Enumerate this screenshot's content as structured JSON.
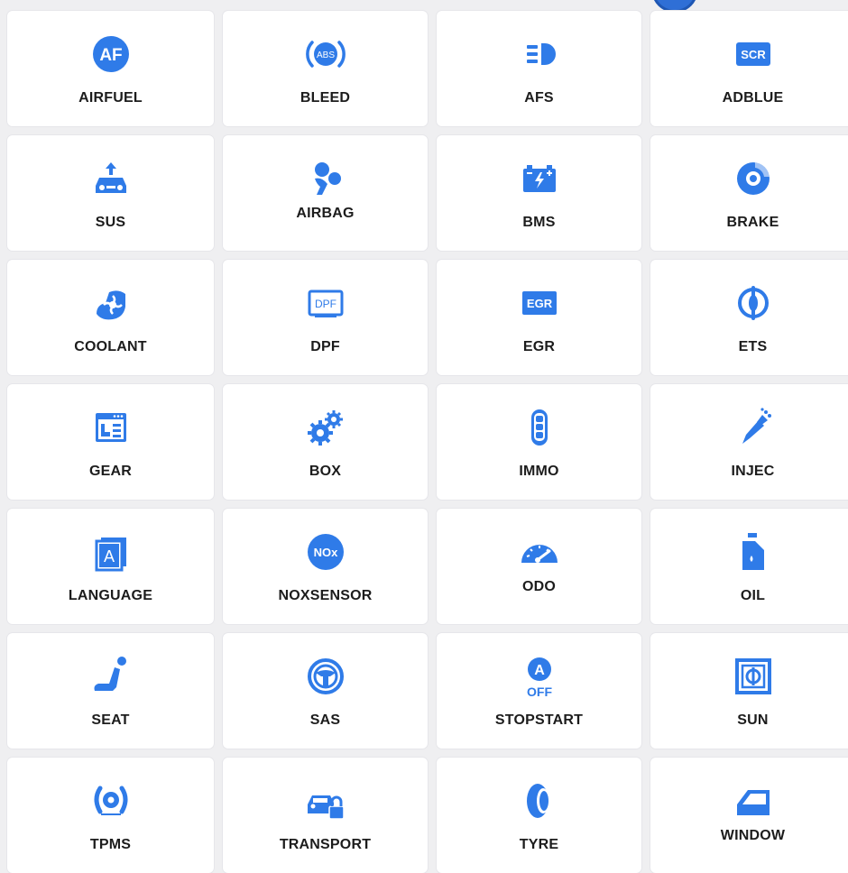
{
  "accent_color": "#2f7be8",
  "tiles": [
    {
      "label": "AIRFUEL",
      "icon": "airfuel-icon",
      "badge": "AF"
    },
    {
      "label": "BLEED",
      "icon": "abs-icon",
      "badge": "ABS"
    },
    {
      "label": "AFS",
      "icon": "headlight-icon"
    },
    {
      "label": "ADBLUE",
      "icon": "scr-icon",
      "badge": "SCR"
    },
    {
      "label": "SUS",
      "icon": "suspension-icon"
    },
    {
      "label": "AIRBAG",
      "icon": "airbag-icon"
    },
    {
      "label": "BMS",
      "icon": "battery-icon"
    },
    {
      "label": "BRAKE",
      "icon": "brake-disc-icon"
    },
    {
      "label": "COOLANT",
      "icon": "coolant-fan-icon"
    },
    {
      "label": "DPF",
      "icon": "dpf-icon",
      "badge": "DPF"
    },
    {
      "label": "EGR",
      "icon": "egr-icon",
      "badge": "EGR"
    },
    {
      "label": "ETS",
      "icon": "throttle-icon"
    },
    {
      "label": "GEAR",
      "icon": "gearbox-window-icon"
    },
    {
      "label": "BOX",
      "icon": "gears-icon"
    },
    {
      "label": "IMMO",
      "icon": "key-fob-icon"
    },
    {
      "label": "INJEC",
      "icon": "injector-icon"
    },
    {
      "label": "LANGUAGE",
      "icon": "language-icon",
      "badge": "A"
    },
    {
      "label": "NOXSENSOR",
      "icon": "nox-icon",
      "badge": "NOx"
    },
    {
      "label": "ODO",
      "icon": "speedometer-icon"
    },
    {
      "label": "OIL",
      "icon": "oil-can-icon"
    },
    {
      "label": "SEAT",
      "icon": "seat-icon"
    },
    {
      "label": "SAS",
      "icon": "steering-wheel-icon"
    },
    {
      "label": "STOPSTART",
      "icon": "auto-stop-start-icon",
      "badge": "A",
      "sub": "OFF"
    },
    {
      "label": "SUN",
      "icon": "sunroof-icon"
    },
    {
      "label": "TPMS",
      "icon": "tpms-icon"
    },
    {
      "label": "TRANSPORT",
      "icon": "transport-lock-icon"
    },
    {
      "label": "TYRE",
      "icon": "tyre-icon"
    },
    {
      "label": "WINDOW",
      "icon": "car-window-icon"
    }
  ]
}
